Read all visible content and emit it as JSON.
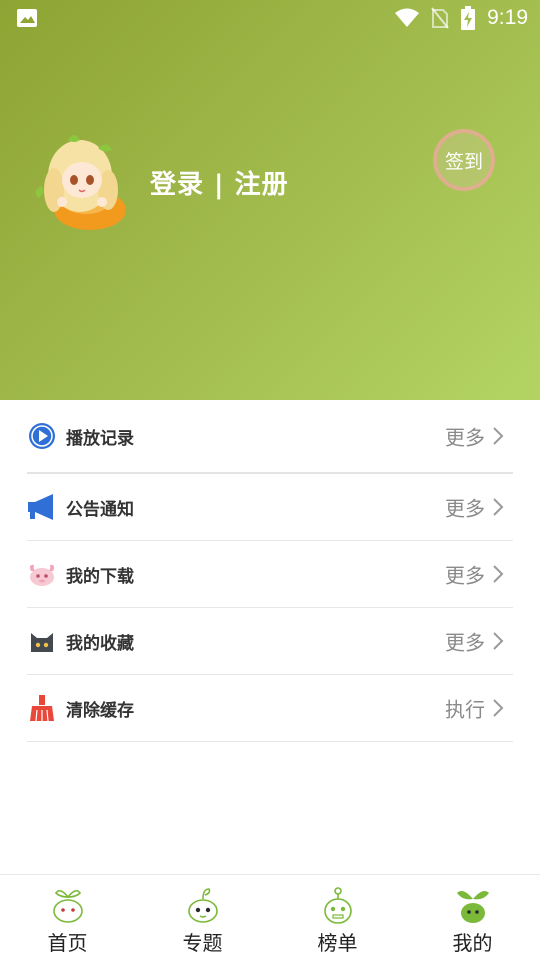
{
  "status_bar": {
    "time": "9:19",
    "icons": [
      "image-icon",
      "wifi-icon",
      "no-sim-icon",
      "battery-charging-icon"
    ]
  },
  "header": {
    "login_text": "登录 | 注册",
    "signin_label": "签到",
    "avatar": "anime-girl-orange-avatar"
  },
  "menu": [
    {
      "label": "播放记录",
      "action": "更多",
      "icon": "play-circle-icon",
      "color": "#2f6fd6"
    },
    {
      "label": "公告通知",
      "action": "更多",
      "icon": "megaphone-icon",
      "color": "#2f6fd6"
    },
    {
      "label": "我的下载",
      "action": "更多",
      "icon": "pink-creature-icon",
      "color": "#f2a3b5"
    },
    {
      "label": "我的收藏",
      "action": "更多",
      "icon": "cat-icon",
      "color": "#44494f"
    },
    {
      "label": "清除缓存",
      "action": "执行",
      "icon": "broom-icon",
      "color": "#e8473a"
    }
  ],
  "bottom_nav": [
    {
      "label": "首页",
      "icon": "sprout-home-icon",
      "active": false
    },
    {
      "label": "专题",
      "icon": "sprout-topics-icon",
      "active": false
    },
    {
      "label": "榜单",
      "icon": "sprout-ranking-icon",
      "active": false
    },
    {
      "label": "我的",
      "icon": "sprout-mine-icon",
      "active": true
    }
  ],
  "colors": {
    "header_start": "#8ea433",
    "header_end": "#b3d463",
    "accent_green": "#7bb93a"
  }
}
